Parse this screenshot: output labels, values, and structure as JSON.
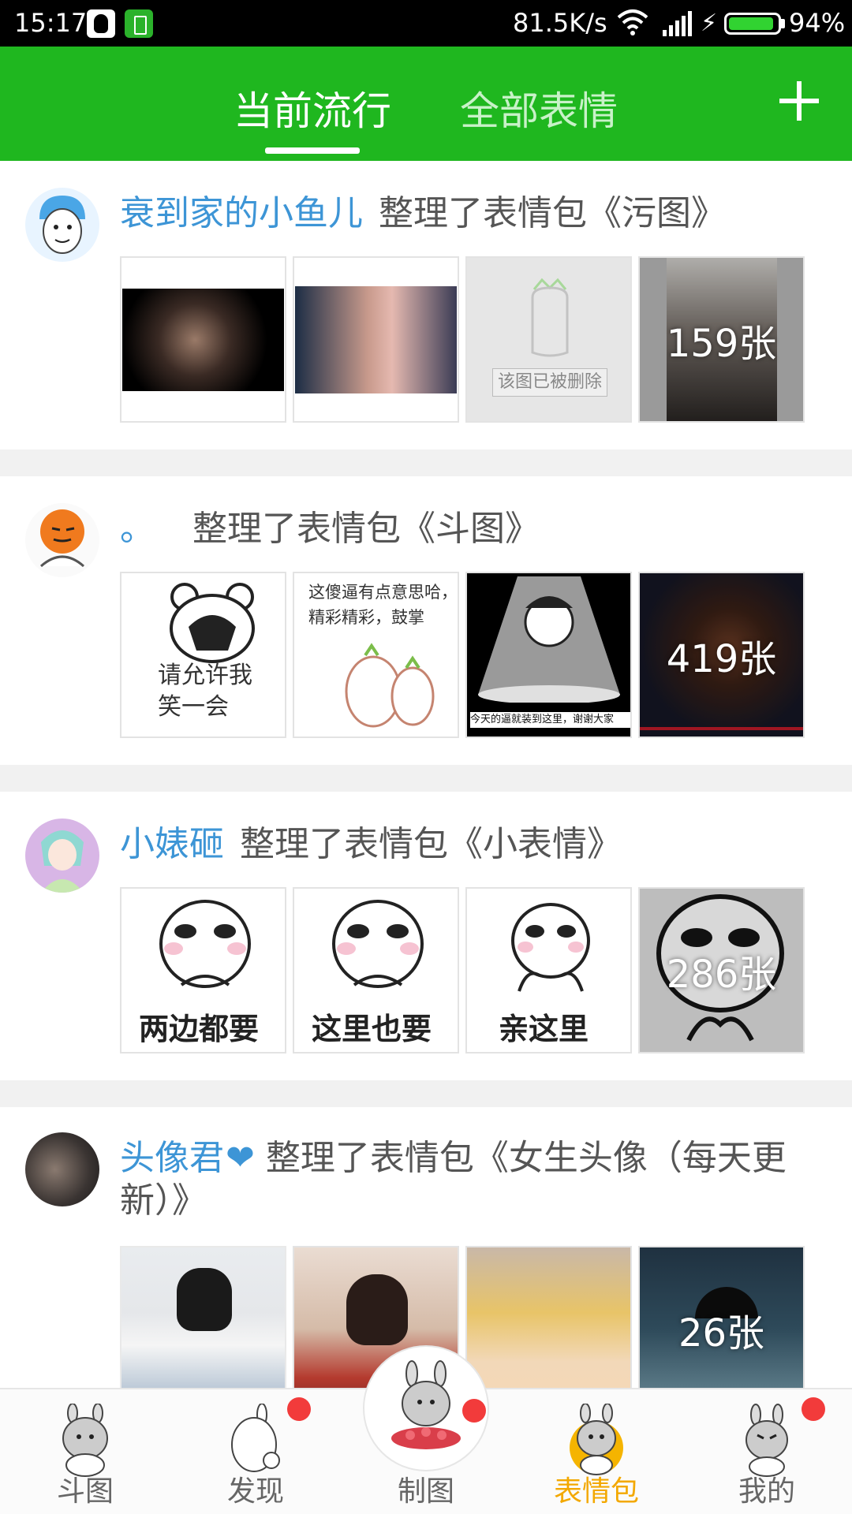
{
  "status_bar": {
    "time": "15:17",
    "network_speed": "81.5K/s",
    "battery_percent": "94%",
    "battery_level": 0.94
  },
  "header": {
    "tabs": [
      {
        "label": "当前流行",
        "active": true
      },
      {
        "label": "全部表情",
        "active": false
      }
    ],
    "add_icon": "plus-icon",
    "bg_color": "#1fb71f"
  },
  "feed": [
    {
      "user": "衰到家的小鱼儿",
      "action": "整理了表情包《污图》",
      "thumbs": [
        {
          "type": "photo",
          "caption": ""
        },
        {
          "type": "photo",
          "caption": ""
        },
        {
          "type": "deleted",
          "caption": "该图已被删除"
        },
        {
          "type": "photo",
          "count": "159张"
        }
      ]
    },
    {
      "user": "。",
      "action": "整理了表情包《斗图》",
      "thumbs": [
        {
          "type": "meme",
          "caption": "请允许我\n笑一会"
        },
        {
          "type": "meme",
          "caption": "这傻逼有点意思哈，\n精彩精彩，鼓掌"
        },
        {
          "type": "meme",
          "caption": "今天的逼就装到这里，谢谢大家"
        },
        {
          "type": "photo",
          "count": "419张"
        }
      ]
    },
    {
      "user": "小婊砸",
      "action": "整理了表情包《小表情》",
      "thumbs": [
        {
          "type": "meme",
          "caption": "两边都要"
        },
        {
          "type": "meme",
          "caption": "这里也要"
        },
        {
          "type": "meme",
          "caption": "亲这里"
        },
        {
          "type": "meme",
          "count": "286张"
        }
      ]
    },
    {
      "user": "头像君",
      "action": "整理了表情包《女生头像（每天更新）》",
      "thumbs": [
        {
          "type": "photo",
          "caption": ""
        },
        {
          "type": "photo",
          "caption": ""
        },
        {
          "type": "photo",
          "caption": ""
        },
        {
          "type": "photo",
          "count": "26张"
        }
      ]
    }
  ],
  "bottom_nav": [
    {
      "label": "斗图",
      "badge": false
    },
    {
      "label": "发现",
      "badge": true
    },
    {
      "label": "制图",
      "badge": true
    },
    {
      "label": "表情包",
      "badge": false,
      "active": true
    },
    {
      "label": "我的",
      "badge": true
    }
  ]
}
